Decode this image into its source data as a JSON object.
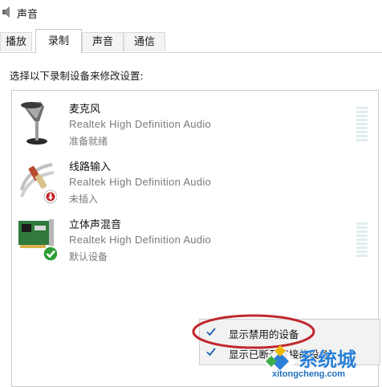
{
  "window": {
    "title": "声音"
  },
  "tabs": [
    {
      "label": "播放",
      "active": false
    },
    {
      "label": "录制",
      "active": true
    },
    {
      "label": "声音",
      "active": false
    },
    {
      "label": "通信",
      "active": false
    }
  ],
  "instruction": "选择以下录制设备来修改设置:",
  "devices": [
    {
      "name": "麦克风",
      "driver": "Realtek High Definition Audio",
      "status": "准备就绪",
      "icon": "microphone-icon"
    },
    {
      "name": "线路输入",
      "driver": "Realtek High Definition Audio",
      "status": "未插入",
      "icon": "line-in-cable-icon"
    },
    {
      "name": "立体声混音",
      "driver": "Realtek High Definition Audio",
      "status": "默认设备",
      "icon": "sound-card-icon"
    }
  ],
  "context_menu": {
    "items": [
      {
        "label": "显示禁用的设备",
        "checked": true
      },
      {
        "label": "显示已断开连接的设备",
        "checked": true
      }
    ]
  },
  "watermark": {
    "brand": "系统城",
    "url": "xitongcheng.com"
  },
  "colors": {
    "highlight_ellipse": "#c0282d",
    "check": "#1e5fb4",
    "watermark_blue": "#2a7fd6"
  }
}
